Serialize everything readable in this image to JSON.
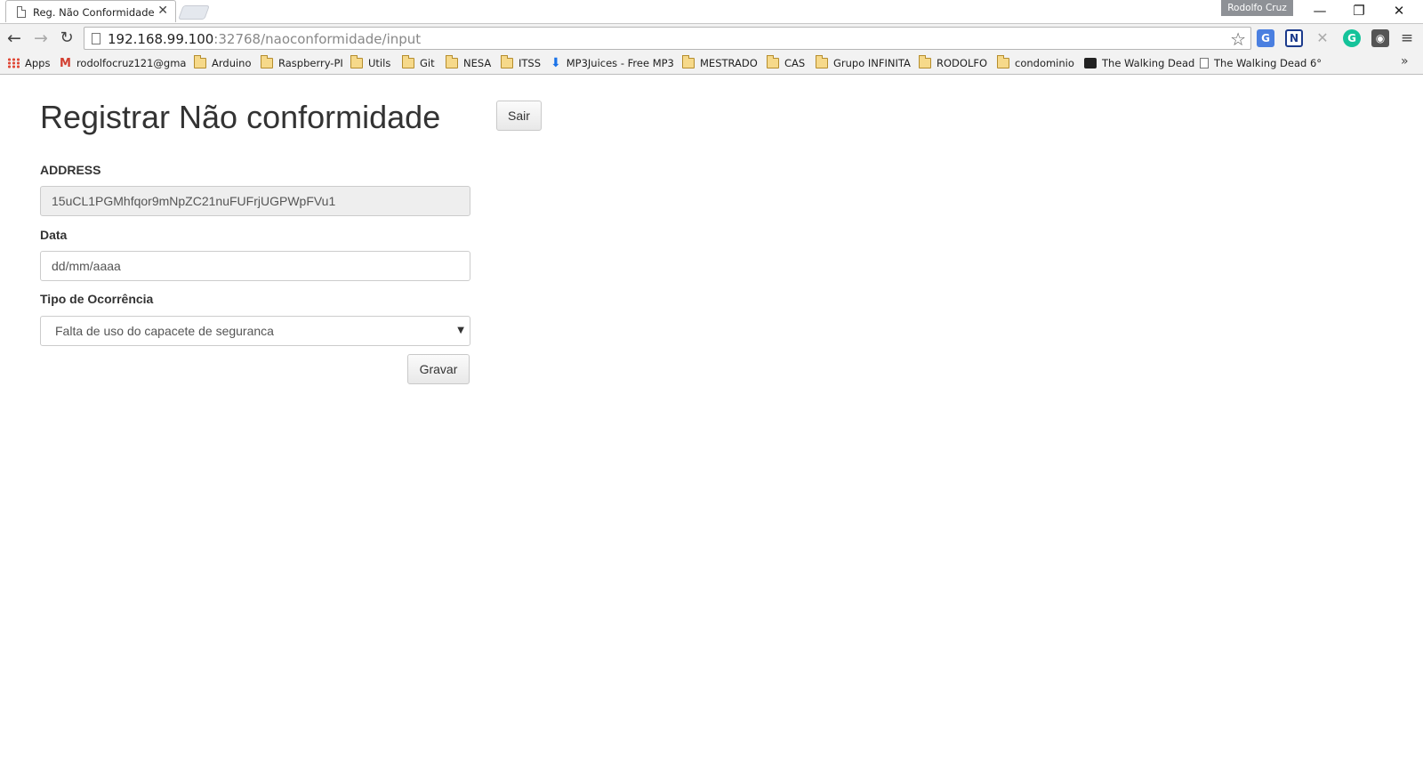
{
  "browser": {
    "tab_title": "Reg. Não Conformidade",
    "tab_close": "✕",
    "profile_name": "Rodolfo Cruz",
    "window_controls": {
      "minimize": "—",
      "restore": "❐",
      "close": "✕"
    },
    "url_host": "192.168.99.100",
    "url_rest": ":32768/naoconformidade/input",
    "icons": {
      "back": "arrow-left-icon",
      "forward": "arrow-right-icon",
      "reload": "reload-icon",
      "star": "star-icon",
      "menu": "hamburger-menu-icon"
    },
    "bookmarks": [
      {
        "label": "Apps",
        "icon": "apps-icon"
      },
      {
        "label": "rodolfocruz121@gma",
        "icon": "gmail-icon"
      },
      {
        "label": "Arduino",
        "icon": "folder-icon"
      },
      {
        "label": "Raspberry-PI",
        "icon": "folder-icon"
      },
      {
        "label": "Utils",
        "icon": "folder-icon"
      },
      {
        "label": "Git",
        "icon": "folder-icon"
      },
      {
        "label": "NESA",
        "icon": "folder-icon"
      },
      {
        "label": "ITSS",
        "icon": "folder-icon"
      },
      {
        "label": "MP3Juices - Free MP3",
        "icon": "download-icon"
      },
      {
        "label": "MESTRADO",
        "icon": "folder-icon"
      },
      {
        "label": "CAS",
        "icon": "folder-icon"
      },
      {
        "label": "Grupo INFINITA",
        "icon": "folder-icon"
      },
      {
        "label": "RODOLFO",
        "icon": "folder-icon"
      },
      {
        "label": "condominio",
        "icon": "folder-icon"
      },
      {
        "label": "The Walking Dead",
        "icon": "heart-icon"
      },
      {
        "label": "The Walking Dead 6°",
        "icon": "page-icon"
      }
    ],
    "bookmarks_more": "»"
  },
  "page": {
    "title": "Registrar Não conformidade",
    "sair_label": "Sair",
    "address_label": "ADDRESS",
    "address_value": "15uCL1PGMhfqor9mNpZC21nuFUFrjUGPWpFVu1",
    "data_label": "Data",
    "data_placeholder": "dd/mm/aaaa",
    "tipo_label": "Tipo de Ocorrência",
    "tipo_selected": "Falta de uso do capacete de seguranca",
    "gravar_label": "Gravar"
  }
}
